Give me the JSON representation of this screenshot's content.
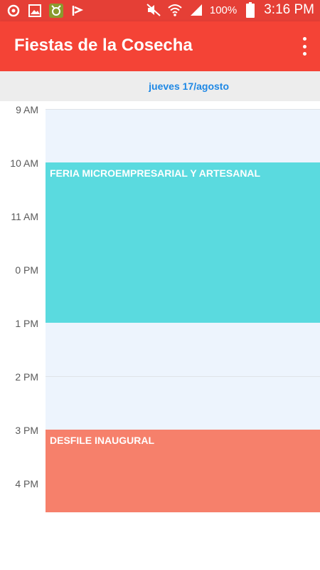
{
  "status_bar": {
    "battery": "100%",
    "time": "3:16 PM",
    "icons": [
      "sync-icon",
      "image-icon",
      "app-badge-icon",
      "check-flag-icon",
      "mute-icon",
      "wifi-icon",
      "signal-icon",
      "battery-icon"
    ]
  },
  "app_bar": {
    "title": "Fiestas de la Cosecha",
    "menu_icon": "more-vert-icon"
  },
  "date_header": "jueves 17/agosto",
  "hours": [
    "9 AM",
    "10 AM",
    "11 AM",
    "0 PM",
    "1 PM",
    "2 PM",
    "3 PM",
    "4 PM"
  ],
  "events": [
    {
      "title": "FERIA MICROEMPRESARIAL Y ARTESANAL",
      "color": "#5adadf"
    },
    {
      "title": "DESFILE INAUGURAL",
      "color": "#f6806b"
    }
  ],
  "colors": {
    "status_bar": "#e53f36",
    "app_bar": "#f44336",
    "date_text": "#1e88e5",
    "grid_background": "#edf4fd"
  }
}
